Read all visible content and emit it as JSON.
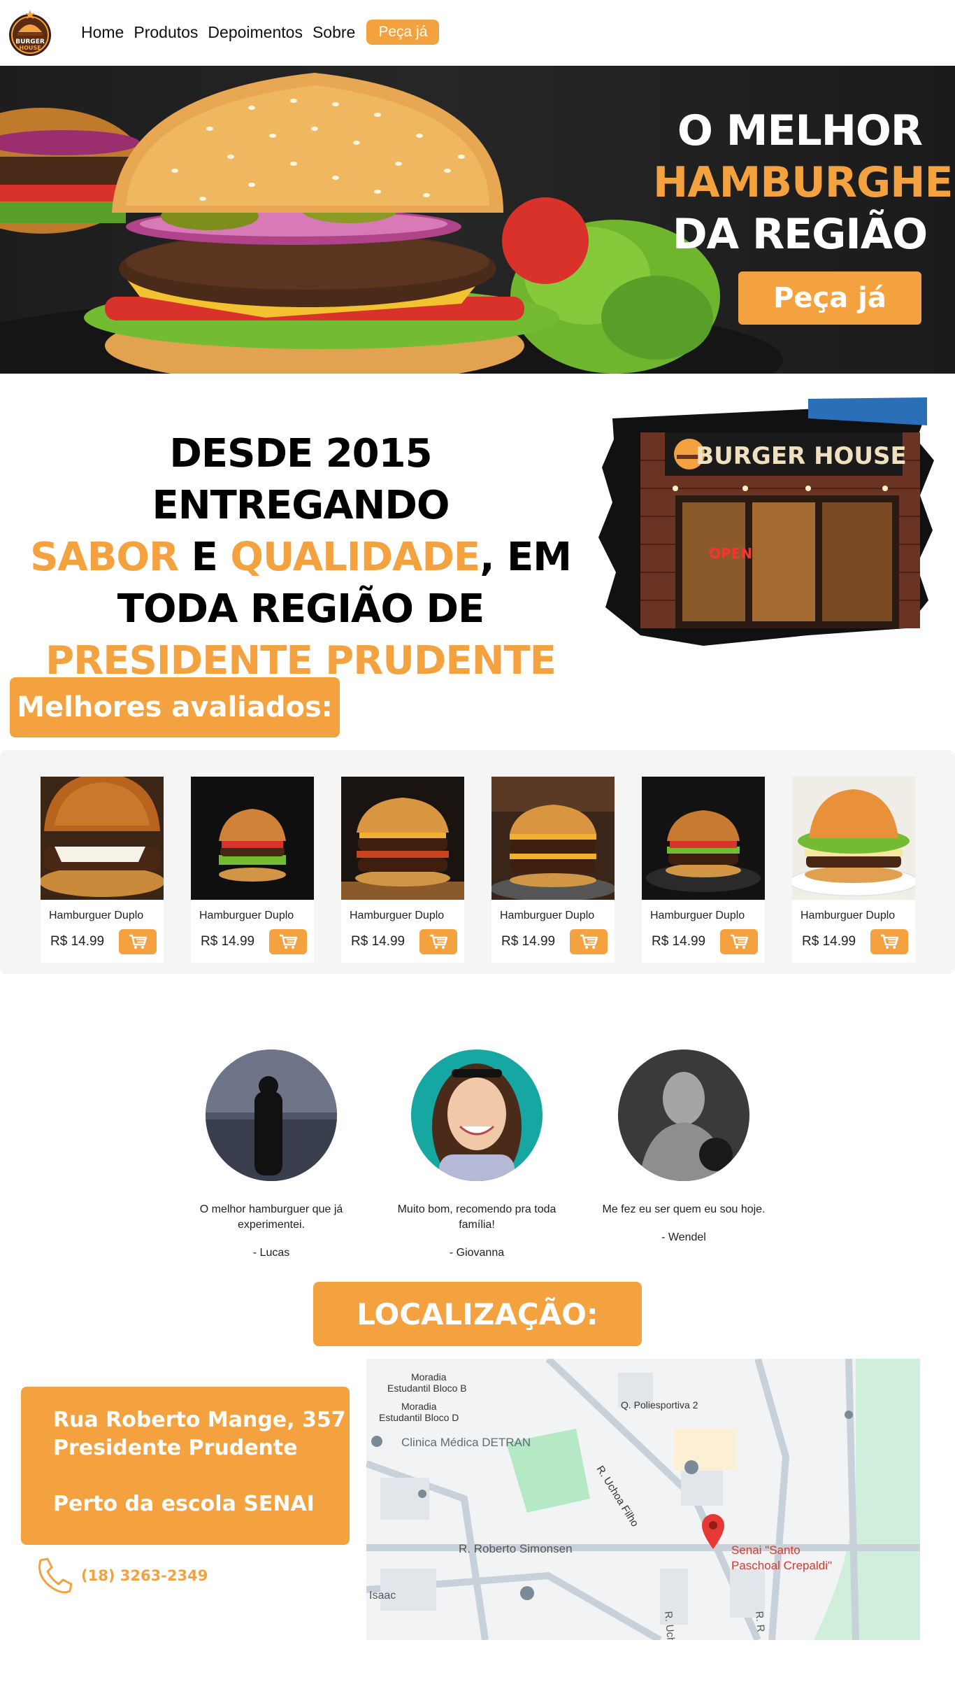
{
  "brand": {
    "logo_lines": [
      "BURGER",
      "HOUSE"
    ],
    "accent_color": "#f4a13f"
  },
  "nav": {
    "links": [
      "Home",
      "Produtos",
      "Depoimentos",
      "Sobre"
    ],
    "cta": "Peça já"
  },
  "hero": {
    "line1": "O MELHOR",
    "line2": "HAMBURGHER",
    "line3": "DA REGIÃO",
    "cta": "Peça já"
  },
  "about": {
    "part1": "DESDE 2015 ENTREGANDO",
    "word_sabor": "SABOR",
    "word_e": " E ",
    "word_qualidade": "QUALIDADE",
    "part_em": ", EM",
    "part2": "TODA REGIÃO DE",
    "city": "PRESIDENTE PRUDENTE",
    "storefront_sign": "BURGER HOUSE",
    "storefront_open": "OPEN"
  },
  "best": {
    "title": "Melhores avaliados:",
    "products": [
      {
        "name": "Hamburguer Duplo",
        "price": "R$ 14.99"
      },
      {
        "name": "Hamburguer Duplo",
        "price": "R$ 14.99"
      },
      {
        "name": "Hamburguer Duplo",
        "price": "R$ 14.99"
      },
      {
        "name": "Hamburguer Duplo",
        "price": "R$ 14.99"
      },
      {
        "name": "Hamburguer Duplo",
        "price": "R$ 14.99"
      },
      {
        "name": "Hamburguer Duplo",
        "price": "R$ 14.99"
      }
    ]
  },
  "testimonials": [
    {
      "quote": "O melhor hamburguer que já experimentei.",
      "author": "- Lucas"
    },
    {
      "quote": "Muito bom, recomendo pra toda família!",
      "author": "- Giovanna"
    },
    {
      "quote": "Me fez eu ser quem eu sou hoje.",
      "author": "- Wendel"
    }
  ],
  "location": {
    "title": "LOCALIZAÇÃO:",
    "street": "Rua Roberto Mange, 357",
    "city": "Presidente Prudente",
    "note": "Perto da escola SENAI",
    "phone": "(18) 3263-2349",
    "map_labels": {
      "moradia_b_1": "Moradia",
      "moradia_b_2": "Estudantil Bloco B",
      "moradia_d_1": "Moradia",
      "moradia_d_2": "Estudantil Bloco D",
      "poli": "Q. Poliesportiva 2",
      "clinica": "Clinica Médica DETRAN",
      "uchoa": "R. Uchoa Filho",
      "simonsen": "R. Roberto Simonsen",
      "senai_1": "Senai \"Santo",
      "senai_2": "Paschoal Crepaldi\"",
      "isaac": "Isaac",
      "uch": "R. Uch",
      "rr": "R. R"
    }
  }
}
